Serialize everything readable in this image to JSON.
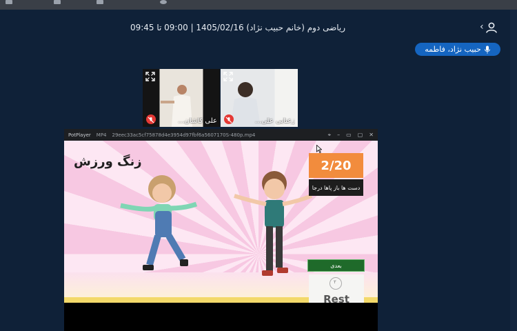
{
  "header": {
    "session_title": "ریاضی دوم (خانم حبیب نژاد) 1405/02/16 | 09:00 تا 09:45",
    "speaker": "حبیب نژاد، فاطمه"
  },
  "tiles": [
    {
      "label": "علی کاشان...",
      "muted": true
    },
    {
      "label": "زعنابی علی...",
      "muted": true
    }
  ],
  "player": {
    "app_name": "PotPlayer",
    "format": "MP4",
    "file_name": "29eec33ac5cf75878d4e3954d97fbf6a5607170S-480p.mp4",
    "window_controls": [
      "⌖",
      "–",
      "▭",
      "▢",
      "✕"
    ]
  },
  "game": {
    "title": "زنگ ورزش",
    "counter": "2/20",
    "instruction": "دست ها باز پاها درجا",
    "next_label": "بعدی",
    "timer": "۲",
    "rest_label": "Rest"
  },
  "colors": {
    "background": "#0f2138",
    "speaker_pill": "#1565c0",
    "counter": "#f28c3d",
    "next_button": "#1f6a2a"
  }
}
